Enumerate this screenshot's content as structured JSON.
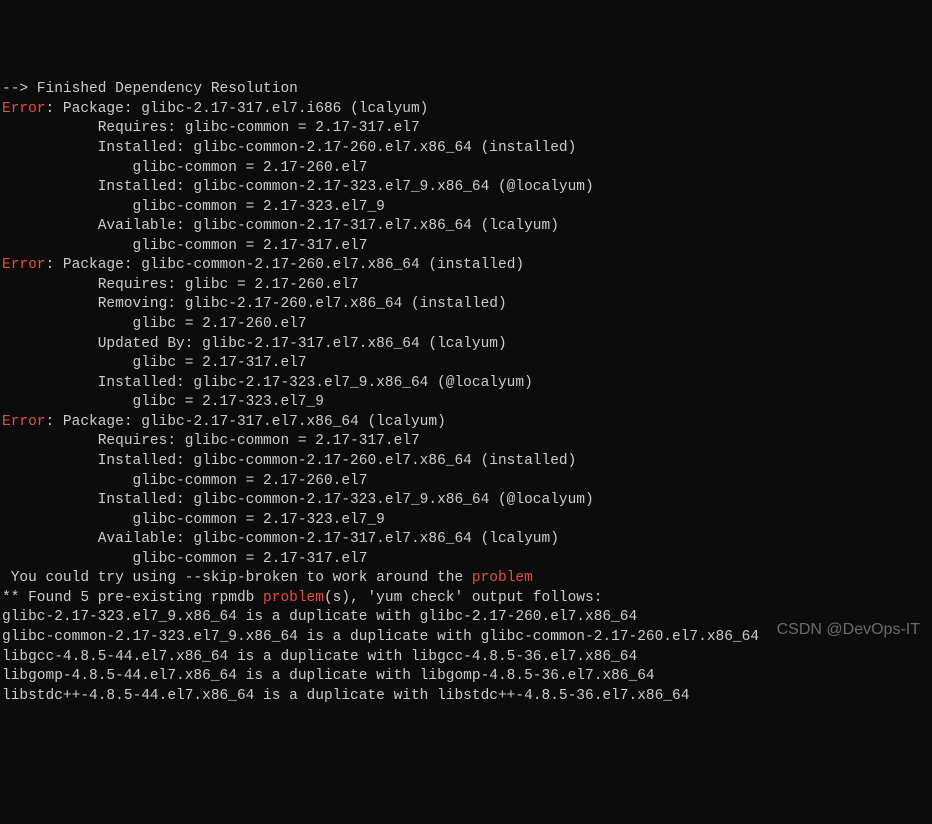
{
  "lines": [
    {
      "segments": [
        {
          "text": "--> Finished Dependency Resolution",
          "class": ""
        }
      ]
    },
    {
      "segments": [
        {
          "text": "Error",
          "class": "red"
        },
        {
          "text": ": Package: glibc-2.17-317.el7.i686 (lcalyum)",
          "class": ""
        }
      ]
    },
    {
      "segments": [
        {
          "text": "           Requires: glibc-common = 2.17-317.el7",
          "class": ""
        }
      ]
    },
    {
      "segments": [
        {
          "text": "           Installed: glibc-common-2.17-260.el7.x86_64 (installed)",
          "class": ""
        }
      ]
    },
    {
      "segments": [
        {
          "text": "               glibc-common = 2.17-260.el7",
          "class": ""
        }
      ]
    },
    {
      "segments": [
        {
          "text": "           Installed: glibc-common-2.17-323.el7_9.x86_64 (@localyum)",
          "class": ""
        }
      ]
    },
    {
      "segments": [
        {
          "text": "               glibc-common = 2.17-323.el7_9",
          "class": ""
        }
      ]
    },
    {
      "segments": [
        {
          "text": "           Available: glibc-common-2.17-317.el7.x86_64 (lcalyum)",
          "class": ""
        }
      ]
    },
    {
      "segments": [
        {
          "text": "               glibc-common = 2.17-317.el7",
          "class": ""
        }
      ]
    },
    {
      "segments": [
        {
          "text": "Error",
          "class": "red"
        },
        {
          "text": ": Package: glibc-common-2.17-260.el7.x86_64 (installed)",
          "class": ""
        }
      ]
    },
    {
      "segments": [
        {
          "text": "           Requires: glibc = 2.17-260.el7",
          "class": ""
        }
      ]
    },
    {
      "segments": [
        {
          "text": "           Removing: glibc-2.17-260.el7.x86_64 (installed)",
          "class": ""
        }
      ]
    },
    {
      "segments": [
        {
          "text": "               glibc = 2.17-260.el7",
          "class": ""
        }
      ]
    },
    {
      "segments": [
        {
          "text": "           Updated By: glibc-2.17-317.el7.x86_64 (lcalyum)",
          "class": ""
        }
      ]
    },
    {
      "segments": [
        {
          "text": "               glibc = 2.17-317.el7",
          "class": ""
        }
      ]
    },
    {
      "segments": [
        {
          "text": "           Installed: glibc-2.17-323.el7_9.x86_64 (@localyum)",
          "class": ""
        }
      ]
    },
    {
      "segments": [
        {
          "text": "               glibc = 2.17-323.el7_9",
          "class": ""
        }
      ]
    },
    {
      "segments": [
        {
          "text": "Error",
          "class": "red"
        },
        {
          "text": ": Package: glibc-2.17-317.el7.x86_64 (lcalyum)",
          "class": ""
        }
      ]
    },
    {
      "segments": [
        {
          "text": "           Requires: glibc-common = 2.17-317.el7",
          "class": ""
        }
      ]
    },
    {
      "segments": [
        {
          "text": "           Installed: glibc-common-2.17-260.el7.x86_64 (installed)",
          "class": ""
        }
      ]
    },
    {
      "segments": [
        {
          "text": "               glibc-common = 2.17-260.el7",
          "class": ""
        }
      ]
    },
    {
      "segments": [
        {
          "text": "           Installed: glibc-common-2.17-323.el7_9.x86_64 (@localyum)",
          "class": ""
        }
      ]
    },
    {
      "segments": [
        {
          "text": "               glibc-common = 2.17-323.el7_9",
          "class": ""
        }
      ]
    },
    {
      "segments": [
        {
          "text": "           Available: glibc-common-2.17-317.el7.x86_64 (lcalyum)",
          "class": ""
        }
      ]
    },
    {
      "segments": [
        {
          "text": "               glibc-common = 2.17-317.el7",
          "class": ""
        }
      ]
    },
    {
      "segments": [
        {
          "text": " You could try using --skip-broken to work around the ",
          "class": ""
        },
        {
          "text": "problem",
          "class": "red"
        }
      ]
    },
    {
      "segments": [
        {
          "text": "** Found 5 pre-existing rpmdb ",
          "class": ""
        },
        {
          "text": "problem",
          "class": "red"
        },
        {
          "text": "(s), 'yum check' output follows:",
          "class": ""
        }
      ]
    },
    {
      "segments": [
        {
          "text": "glibc-2.17-323.el7_9.x86_64 is a duplicate with glibc-2.17-260.el7.x86_64",
          "class": ""
        }
      ]
    },
    {
      "segments": [
        {
          "text": "glibc-common-2.17-323.el7_9.x86_64 is a duplicate with glibc-common-2.17-260.el7.x86_64",
          "class": ""
        }
      ]
    },
    {
      "segments": [
        {
          "text": "libgcc-4.8.5-44.el7.x86_64 is a duplicate with libgcc-4.8.5-36.el7.x86_64",
          "class": ""
        }
      ]
    },
    {
      "segments": [
        {
          "text": "libgomp-4.8.5-44.el7.x86_64 is a duplicate with libgomp-4.8.5-36.el7.x86_64",
          "class": ""
        }
      ]
    },
    {
      "segments": [
        {
          "text": "libstdc++-4.8.5-44.el7.x86_64 is a duplicate with libstdc++-4.8.5-36.el7.x86_64",
          "class": ""
        }
      ]
    }
  ],
  "watermark": "CSDN @DevOps-IT"
}
